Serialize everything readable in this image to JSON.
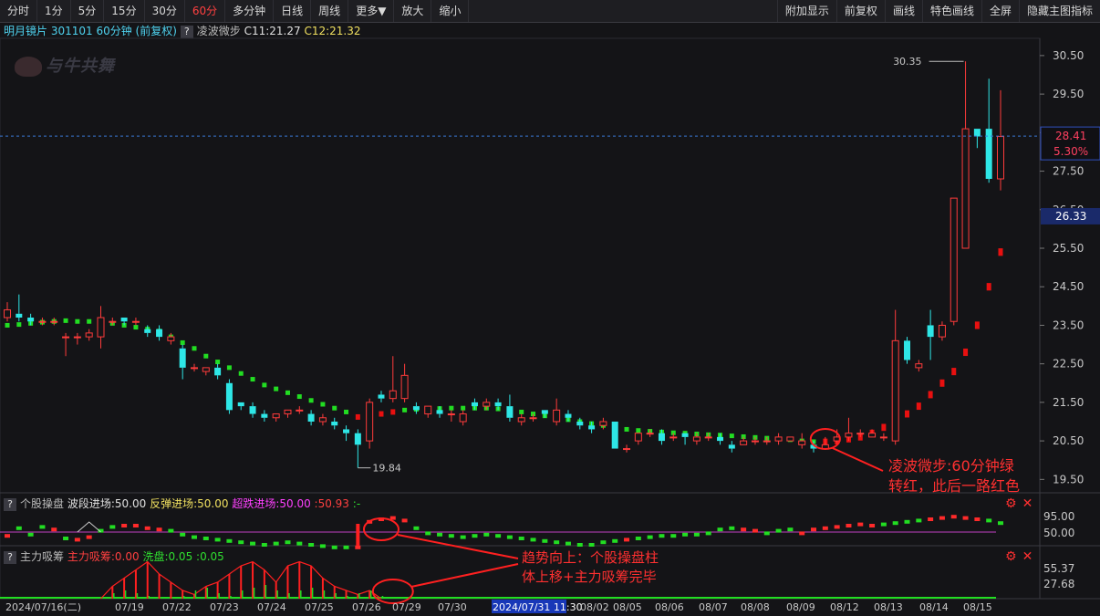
{
  "toolbar": {
    "left": [
      "分时",
      "1分",
      "5分",
      "15分",
      "30分",
      "60分",
      "多分钟",
      "日线",
      "周线",
      "更多▼",
      "放大",
      "缩小"
    ],
    "active": "60分",
    "right": [
      "附加显示",
      "前复权",
      "画线",
      "特色画线",
      "全屏",
      "隐藏主图指标"
    ]
  },
  "info": {
    "title": "明月镜片 301101 60分钟",
    "adjust": "(前复权)",
    "indicator": "凌波微步",
    "c1": "C11:21.27",
    "c2": "C12:21.32"
  },
  "logo": "与牛共舞",
  "price_axis": {
    "ticks": [
      "30.50",
      "29.50",
      "28.50",
      "27.50",
      "26.50",
      "25.50",
      "24.50",
      "23.50",
      "22.50",
      "21.50",
      "20.50",
      "19.50"
    ],
    "current_price": "28.41",
    "current_change": "5.30%",
    "cursor_price": "26.33"
  },
  "annotations": {
    "high": "30.35",
    "low": "19.84",
    "main_note_1": "凌波微步:60分钟绿",
    "main_note_2": "转红，此后一路红色",
    "sub_note_1": "趋势向上：个股操盘柱",
    "sub_note_2": "体上移+主力吸筹完毕"
  },
  "panel1": {
    "name": "个股操盘",
    "l1": "波段进场:50.00",
    "l2": "反弹进场:50.00",
    "l3": "超跌进场:50.00",
    "l4": ":50.93",
    "l5": ":-",
    "ticks": [
      "95.00",
      "50.00"
    ]
  },
  "panel2": {
    "name": "主力吸筹",
    "l1": "主力吸筹:0.00",
    "l2": "洗盘:0.05",
    "l3": ":0.05",
    "ticks": [
      "55.37",
      "27.68"
    ]
  },
  "x_axis": {
    "labels": [
      "2024/07/16(二)",
      "07/19",
      "07/22",
      "07/23",
      "07/24",
      "07/25",
      "07/26",
      "07/29",
      "07/30",
      "2024/07/31 11:30",
      "08/02",
      "08/05",
      "08/06",
      "08/07",
      "08/08",
      "08/09",
      "08/12",
      "08/13",
      "08/14",
      "08/15"
    ]
  },
  "colors": {
    "up": "#ff3b3b",
    "down": "#2ee6e6",
    "ma_up": "#e81010",
    "ma_down": "#22dd22",
    "bg": "#141417"
  },
  "chart_data": {
    "type": "candlestick",
    "title": "明月镜片 301101 60分钟",
    "ylim": [
      19.2,
      30.9
    ],
    "candles": [
      [
        23.7,
        23.9,
        24.1,
        23.6
      ],
      [
        23.8,
        23.7,
        24.3,
        23.6
      ],
      [
        23.7,
        23.6,
        23.8,
        23.5
      ],
      [
        23.6,
        23.6,
        23.7,
        23.5
      ],
      [
        23.6,
        23.6,
        23.7,
        23.5
      ],
      [
        23.2,
        23.2,
        23.3,
        22.7
      ],
      [
        23.2,
        23.2,
        23.3,
        23.0
      ],
      [
        23.2,
        23.3,
        23.4,
        23.1
      ],
      [
        23.2,
        23.7,
        24.0,
        22.9
      ],
      [
        23.6,
        23.6,
        23.7,
        23.5
      ],
      [
        23.7,
        23.6,
        23.7,
        23.5
      ],
      [
        23.6,
        23.6,
        23.7,
        23.5
      ],
      [
        23.4,
        23.3,
        23.5,
        23.2
      ],
      [
        23.4,
        23.2,
        23.5,
        23.1
      ],
      [
        23.1,
        23.2,
        23.3,
        23.0
      ],
      [
        22.9,
        22.4,
        23.0,
        22.1
      ],
      [
        22.4,
        22.4,
        22.5,
        22.3
      ],
      [
        22.3,
        22.4,
        22.4,
        22.2
      ],
      [
        22.4,
        22.2,
        22.5,
        22.1
      ],
      [
        22.0,
        21.3,
        22.1,
        21.2
      ],
      [
        21.5,
        21.4,
        21.5,
        21.3
      ],
      [
        21.4,
        21.2,
        21.5,
        21.1
      ],
      [
        21.2,
        21.1,
        21.3,
        21.0
      ],
      [
        21.1,
        21.2,
        21.2,
        21.0
      ],
      [
        21.2,
        21.3,
        21.3,
        21.1
      ],
      [
        21.3,
        21.3,
        21.4,
        21.2
      ],
      [
        21.2,
        21.0,
        21.3,
        20.9
      ],
      [
        21.0,
        21.1,
        21.2,
        20.9
      ],
      [
        21.0,
        20.9,
        21.1,
        20.8
      ],
      [
        20.8,
        20.7,
        20.9,
        20.5
      ],
      [
        20.7,
        20.4,
        20.8,
        19.8
      ],
      [
        20.5,
        21.5,
        21.6,
        20.3
      ],
      [
        21.7,
        21.6,
        21.8,
        21.5
      ],
      [
        21.6,
        21.8,
        22.7,
        21.5
      ],
      [
        21.6,
        22.2,
        22.5,
        21.5
      ],
      [
        21.4,
        21.3,
        21.5,
        21.2
      ],
      [
        21.2,
        21.4,
        21.4,
        21.1
      ],
      [
        21.3,
        21.2,
        21.4,
        21.1
      ],
      [
        21.2,
        21.2,
        21.3,
        21.0
      ],
      [
        21.0,
        21.2,
        21.3,
        20.9
      ],
      [
        21.5,
        21.4,
        21.6,
        21.3
      ],
      [
        21.4,
        21.5,
        21.6,
        21.3
      ],
      [
        21.5,
        21.4,
        21.6,
        21.3
      ],
      [
        21.4,
        21.1,
        21.7,
        21.0
      ],
      [
        21.0,
        21.1,
        21.2,
        20.9
      ],
      [
        21.1,
        21.1,
        21.2,
        21.0
      ],
      [
        21.3,
        21.2,
        21.3,
        21.1
      ],
      [
        21.0,
        21.3,
        21.6,
        20.9
      ],
      [
        21.2,
        21.1,
        21.3,
        21.0
      ],
      [
        21.0,
        20.9,
        21.1,
        20.8
      ],
      [
        20.9,
        20.8,
        21.0,
        20.7
      ],
      [
        20.9,
        21.0,
        21.1,
        20.8
      ],
      [
        21.0,
        20.3,
        21.0,
        20.3
      ],
      [
        20.3,
        20.3,
        20.4,
        20.2
      ],
      [
        20.5,
        20.7,
        20.7,
        20.4
      ],
      [
        20.7,
        20.7,
        20.8,
        20.6
      ],
      [
        20.7,
        20.5,
        20.8,
        20.4
      ],
      [
        20.6,
        20.6,
        20.7,
        20.5
      ],
      [
        20.7,
        20.6,
        20.7,
        20.4
      ],
      [
        20.5,
        20.6,
        20.7,
        20.4
      ],
      [
        20.6,
        20.6,
        20.7,
        20.5
      ],
      [
        20.6,
        20.5,
        20.7,
        20.4
      ],
      [
        20.4,
        20.3,
        20.5,
        20.2
      ],
      [
        20.4,
        20.5,
        20.6,
        20.4
      ],
      [
        20.5,
        20.5,
        20.6,
        20.4
      ],
      [
        20.5,
        20.5,
        20.6,
        20.4
      ],
      [
        20.5,
        20.6,
        20.7,
        20.4
      ],
      [
        20.5,
        20.6,
        20.6,
        20.5
      ],
      [
        20.4,
        20.5,
        20.7,
        20.3
      ],
      [
        20.4,
        20.3,
        20.5,
        20.2
      ],
      [
        20.3,
        20.4,
        20.6,
        20.3
      ],
      [
        20.5,
        20.6,
        20.8,
        20.4
      ],
      [
        20.6,
        20.7,
        21.1,
        20.5
      ],
      [
        20.7,
        20.7,
        20.8,
        20.6
      ],
      [
        20.6,
        20.7,
        20.8,
        20.6
      ],
      [
        20.6,
        20.6,
        20.7,
        20.5
      ],
      [
        20.5,
        23.1,
        23.9,
        20.4
      ],
      [
        23.1,
        22.6,
        23.2,
        22.5
      ],
      [
        22.4,
        22.5,
        22.6,
        22.3
      ],
      [
        23.5,
        23.2,
        23.9,
        22.6
      ],
      [
        23.2,
        23.5,
        23.6,
        23.1
      ],
      [
        23.6,
        26.8,
        26.8,
        23.5
      ],
      [
        25.5,
        28.6,
        30.35,
        25.5
      ],
      [
        28.6,
        28.4,
        28.6,
        28.1
      ],
      [
        28.6,
        27.3,
        29.9,
        27.2
      ],
      [
        27.3,
        28.4,
        29.6,
        27.0
      ]
    ],
    "lingbo": [
      {
        "v": 23.5,
        "dir": "down"
      },
      {
        "v": 23.52,
        "dir": "down"
      },
      {
        "v": 23.55,
        "dir": "down"
      },
      {
        "v": 23.58,
        "dir": "down"
      },
      {
        "v": 23.6,
        "dir": "down"
      },
      {
        "v": 23.62,
        "dir": "down"
      },
      {
        "v": 23.6,
        "dir": "down"
      },
      {
        "v": 23.6,
        "dir": "down"
      },
      {
        "v": 23.58,
        "dir": "down"
      },
      {
        "v": 23.55,
        "dir": "down"
      },
      {
        "v": 23.5,
        "dir": "down"
      },
      {
        "v": 23.45,
        "dir": "down"
      },
      {
        "v": 23.4,
        "dir": "down"
      },
      {
        "v": 23.35,
        "dir": "down"
      },
      {
        "v": 23.2,
        "dir": "down"
      },
      {
        "v": 23.05,
        "dir": "down"
      },
      {
        "v": 22.9,
        "dir": "down"
      },
      {
        "v": 22.7,
        "dir": "down"
      },
      {
        "v": 22.55,
        "dir": "down"
      },
      {
        "v": 22.4,
        "dir": "down"
      },
      {
        "v": 22.25,
        "dir": "down"
      },
      {
        "v": 22.1,
        "dir": "down"
      },
      {
        "v": 21.95,
        "dir": "down"
      },
      {
        "v": 21.85,
        "dir": "down"
      },
      {
        "v": 21.75,
        "dir": "down"
      },
      {
        "v": 21.65,
        "dir": "down"
      },
      {
        "v": 21.55,
        "dir": "down"
      },
      {
        "v": 21.45,
        "dir": "down"
      },
      {
        "v": 21.35,
        "dir": "down"
      },
      {
        "v": 21.25,
        "dir": "down"
      },
      {
        "v": 21.12,
        "dir": "up"
      },
      {
        "v": 21.15,
        "dir": "up"
      },
      {
        "v": 21.2,
        "dir": "up"
      },
      {
        "v": 21.25,
        "dir": "up"
      },
      {
        "v": 21.3,
        "dir": "down"
      },
      {
        "v": 21.32,
        "dir": "down"
      },
      {
        "v": 21.33,
        "dir": "down"
      },
      {
        "v": 21.34,
        "dir": "down"
      },
      {
        "v": 21.35,
        "dir": "down"
      },
      {
        "v": 21.35,
        "dir": "down"
      },
      {
        "v": 21.35,
        "dir": "down"
      },
      {
        "v": 21.35,
        "dir": "down"
      },
      {
        "v": 21.33,
        "dir": "down"
      },
      {
        "v": 21.3,
        "dir": "down"
      },
      {
        "v": 21.25,
        "dir": "down"
      },
      {
        "v": 21.2,
        "dir": "down"
      },
      {
        "v": 21.15,
        "dir": "down"
      },
      {
        "v": 21.1,
        "dir": "down"
      },
      {
        "v": 21.05,
        "dir": "down"
      },
      {
        "v": 21.0,
        "dir": "down"
      },
      {
        "v": 20.95,
        "dir": "down"
      },
      {
        "v": 20.9,
        "dir": "down"
      },
      {
        "v": 20.85,
        "dir": "down"
      },
      {
        "v": 20.8,
        "dir": "down"
      },
      {
        "v": 20.77,
        "dir": "down"
      },
      {
        "v": 20.75,
        "dir": "down"
      },
      {
        "v": 20.73,
        "dir": "down"
      },
      {
        "v": 20.71,
        "dir": "down"
      },
      {
        "v": 20.7,
        "dir": "down"
      },
      {
        "v": 20.68,
        "dir": "down"
      },
      {
        "v": 20.66,
        "dir": "down"
      },
      {
        "v": 20.65,
        "dir": "down"
      },
      {
        "v": 20.63,
        "dir": "down"
      },
      {
        "v": 20.61,
        "dir": "down"
      },
      {
        "v": 20.59,
        "dir": "down"
      },
      {
        "v": 20.57,
        "dir": "down"
      },
      {
        "v": 20.55,
        "dir": "down"
      },
      {
        "v": 20.53,
        "dir": "down"
      },
      {
        "v": 20.5,
        "dir": "down"
      },
      {
        "v": 20.48,
        "dir": "down"
      },
      {
        "v": 20.47,
        "dir": "up"
      },
      {
        "v": 20.5,
        "dir": "up"
      },
      {
        "v": 20.55,
        "dir": "up"
      },
      {
        "v": 20.6,
        "dir": "up"
      },
      {
        "v": 20.7,
        "dir": "up"
      },
      {
        "v": 20.85,
        "dir": "up"
      },
      {
        "v": 21.0,
        "dir": "up"
      },
      {
        "v": 21.2,
        "dir": "up"
      },
      {
        "v": 21.4,
        "dir": "up"
      },
      {
        "v": 21.7,
        "dir": "up"
      },
      {
        "v": 22.0,
        "dir": "up"
      },
      {
        "v": 22.3,
        "dir": "up"
      },
      {
        "v": 22.8,
        "dir": "up"
      },
      {
        "v": 23.5,
        "dir": "up"
      },
      {
        "v": 24.5,
        "dir": "up"
      },
      {
        "v": 25.4,
        "dir": "up"
      }
    ],
    "op_bars": [
      {
        "v": -0.3,
        "c": "r"
      },
      {
        "v": 0.3,
        "c": "g"
      },
      {
        "v": -0.2,
        "c": "g"
      },
      {
        "v": 0.4,
        "c": "g"
      },
      {
        "v": 0.2,
        "c": "r"
      },
      {
        "v": -0.5,
        "c": "g"
      },
      {
        "v": -0.6,
        "c": "r"
      },
      {
        "v": -0.4,
        "c": "r"
      },
      {
        "v": 0.1,
        "c": "g"
      },
      {
        "v": 0.4,
        "c": "g"
      },
      {
        "v": 0.5,
        "c": "r"
      },
      {
        "v": 0.5,
        "c": "r"
      },
      {
        "v": 0.3,
        "c": "r"
      },
      {
        "v": 0.2,
        "c": "r"
      },
      {
        "v": 0.1,
        "c": "g"
      },
      {
        "v": -0.2,
        "c": "g"
      },
      {
        "v": -0.4,
        "c": "g"
      },
      {
        "v": -0.5,
        "c": "g"
      },
      {
        "v": -0.6,
        "c": "g"
      },
      {
        "v": -0.7,
        "c": "g"
      },
      {
        "v": -0.8,
        "c": "g"
      },
      {
        "v": -0.9,
        "c": "g"
      },
      {
        "v": -1.0,
        "c": "g"
      },
      {
        "v": -0.9,
        "c": "g"
      },
      {
        "v": -0.8,
        "c": "g"
      },
      {
        "v": -0.9,
        "c": "g"
      },
      {
        "v": -1.0,
        "c": "g"
      },
      {
        "v": -1.1,
        "c": "g"
      },
      {
        "v": -1.2,
        "c": "g"
      },
      {
        "v": -1.2,
        "c": "g"
      },
      {
        "v": -1.2,
        "c": "r"
      },
      {
        "v": 0.8,
        "c": "r"
      },
      {
        "v": 1.0,
        "c": "r"
      },
      {
        "v": 1.1,
        "c": "r"
      },
      {
        "v": 0.9,
        "c": "r"
      },
      {
        "v": 0.3,
        "c": "g"
      },
      {
        "v": -0.1,
        "c": "g"
      },
      {
        "v": -0.2,
        "c": "g"
      },
      {
        "v": -0.3,
        "c": "g"
      },
      {
        "v": -0.4,
        "c": "g"
      },
      {
        "v": -0.3,
        "c": "g"
      },
      {
        "v": -0.2,
        "c": "g"
      },
      {
        "v": -0.3,
        "c": "g"
      },
      {
        "v": -0.4,
        "c": "g"
      },
      {
        "v": -0.5,
        "c": "g"
      },
      {
        "v": -0.6,
        "c": "g"
      },
      {
        "v": -0.7,
        "c": "g"
      },
      {
        "v": -0.8,
        "c": "g"
      },
      {
        "v": -0.9,
        "c": "g"
      },
      {
        "v": -1.0,
        "c": "g"
      },
      {
        "v": -1.0,
        "c": "g"
      },
      {
        "v": -0.8,
        "c": "g"
      },
      {
        "v": -0.7,
        "c": "g"
      },
      {
        "v": -0.6,
        "c": "r"
      },
      {
        "v": -0.5,
        "c": "g"
      },
      {
        "v": -0.4,
        "c": "g"
      },
      {
        "v": -0.3,
        "c": "g"
      },
      {
        "v": -0.3,
        "c": "g"
      },
      {
        "v": -0.2,
        "c": "g"
      },
      {
        "v": -0.2,
        "c": "g"
      },
      {
        "v": -0.1,
        "c": "g"
      },
      {
        "v": 0.2,
        "c": "g"
      },
      {
        "v": 0.3,
        "c": "g"
      },
      {
        "v": 0.2,
        "c": "r"
      },
      {
        "v": 0.1,
        "c": "r"
      },
      {
        "v": -0.1,
        "c": "g"
      },
      {
        "v": 0.1,
        "c": "g"
      },
      {
        "v": 0.2,
        "c": "g"
      },
      {
        "v": -0.1,
        "c": "r"
      },
      {
        "v": 0.2,
        "c": "r"
      },
      {
        "v": 0.3,
        "c": "r"
      },
      {
        "v": 0.4,
        "c": "r"
      },
      {
        "v": 0.5,
        "c": "r"
      },
      {
        "v": 0.6,
        "c": "r"
      },
      {
        "v": 0.5,
        "c": "r"
      },
      {
        "v": 0.6,
        "c": "g"
      },
      {
        "v": 0.7,
        "c": "g"
      },
      {
        "v": 0.8,
        "c": "g"
      },
      {
        "v": 0.9,
        "c": "g"
      },
      {
        "v": 1.0,
        "c": "r"
      },
      {
        "v": 1.1,
        "c": "r"
      },
      {
        "v": 1.2,
        "c": "r"
      },
      {
        "v": 1.1,
        "c": "r"
      },
      {
        "v": 1.0,
        "c": "r"
      },
      {
        "v": 0.9,
        "c": "g"
      },
      {
        "v": 0.7,
        "c": "g"
      }
    ],
    "xichou": [
      0,
      0,
      0,
      0,
      0,
      0,
      0,
      0,
      0,
      0.3,
      0.5,
      0.7,
      0.9,
      0.6,
      0.4,
      0.2,
      0.1,
      0.3,
      0.4,
      0.6,
      0.8,
      0.9,
      0.7,
      0.4,
      0.8,
      0.9,
      0.8,
      0.5,
      0.3,
      0.2,
      0.1,
      0.2,
      0,
      0,
      0,
      0,
      0,
      0,
      0,
      0,
      0,
      0,
      0,
      0,
      0,
      0,
      0,
      0,
      0,
      0,
      0,
      0,
      0,
      0,
      0,
      0,
      0,
      0,
      0,
      0,
      0,
      0,
      0,
      0,
      0,
      0,
      0,
      0,
      0,
      0,
      0,
      0,
      0,
      0,
      0,
      0,
      0,
      0,
      0,
      0,
      0,
      0,
      0,
      0,
      0,
      0
    ],
    "xipan": [
      0,
      0,
      0,
      0,
      0,
      0,
      0,
      0,
      0,
      0.2,
      0.3,
      0.2,
      0.1,
      0,
      0,
      0.1,
      0.3,
      0.4,
      0.2,
      0.1,
      0.3,
      0.4,
      0.5,
      0.3,
      0.2,
      0.3,
      0.4,
      0.3,
      0.2,
      0.1,
      0.2,
      0.3,
      0.1,
      0,
      0,
      0,
      0,
      0,
      0,
      0,
      0,
      0,
      0,
      0,
      0,
      0,
      0,
      0,
      0,
      0,
      0,
      0,
      0,
      0,
      0,
      0,
      0,
      0,
      0,
      0,
      0,
      0,
      0,
      0,
      0,
      0,
      0,
      0,
      0,
      0,
      0,
      0,
      0,
      0,
      0,
      0,
      0,
      0,
      0,
      0,
      0,
      0,
      0,
      0,
      0,
      0
    ]
  }
}
